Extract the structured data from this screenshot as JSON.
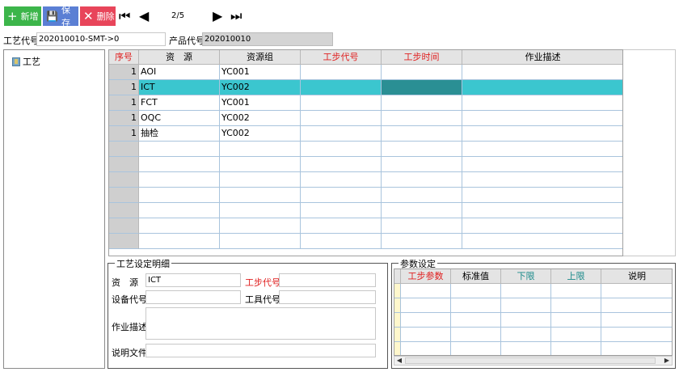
{
  "toolbar": {
    "new_label": "新增",
    "save_label": "保存",
    "delete_label": "删除",
    "page_indicator": "2/5",
    "colors": {
      "new": "#3cb54a",
      "save": "#5b7fd4",
      "delete": "#e8455a"
    }
  },
  "header": {
    "process_code_label": "工艺代号",
    "process_code_value": "202010010-SMT->0",
    "product_code_label": "产品代号",
    "product_code_value": "202010010"
  },
  "tree": {
    "root_label": "工艺"
  },
  "grid": {
    "columns": [
      "序号",
      "资　源",
      "资源组",
      "工步代号",
      "工步时间",
      "作业描述"
    ],
    "rows": [
      {
        "seq": "1",
        "resource": "AOI",
        "group": "YC001",
        "step_code": "",
        "step_time": "",
        "desc": ""
      },
      {
        "seq": "1",
        "resource": "ICT",
        "group": "YC002",
        "step_code": "",
        "step_time": "",
        "desc": ""
      },
      {
        "seq": "1",
        "resource": "FCT",
        "group": "YC001",
        "step_code": "",
        "step_time": "",
        "desc": ""
      },
      {
        "seq": "1",
        "resource": "OQC",
        "group": "YC002",
        "step_code": "",
        "step_time": "",
        "desc": ""
      },
      {
        "seq": "1",
        "resource": "抽检",
        "group": "YC002",
        "step_code": "",
        "step_time": "",
        "desc": ""
      }
    ],
    "selected_row_index": 1
  },
  "detail": {
    "title": "工艺设定明细",
    "resource_label": "资　源",
    "resource_value": "ICT",
    "step_code_label": "工步代号",
    "step_code_value": "",
    "equipment_code_label": "设备代号",
    "equipment_code_value": "",
    "tool_code_label": "工具代号",
    "tool_code_value": "",
    "work_desc_label": "作业描述",
    "work_desc_value": "",
    "doc_label": "说明文件",
    "doc_value": ""
  },
  "params": {
    "title": "参数设定",
    "columns": [
      "工步参数",
      "标准值",
      "下限",
      "上限",
      "说明"
    ]
  }
}
